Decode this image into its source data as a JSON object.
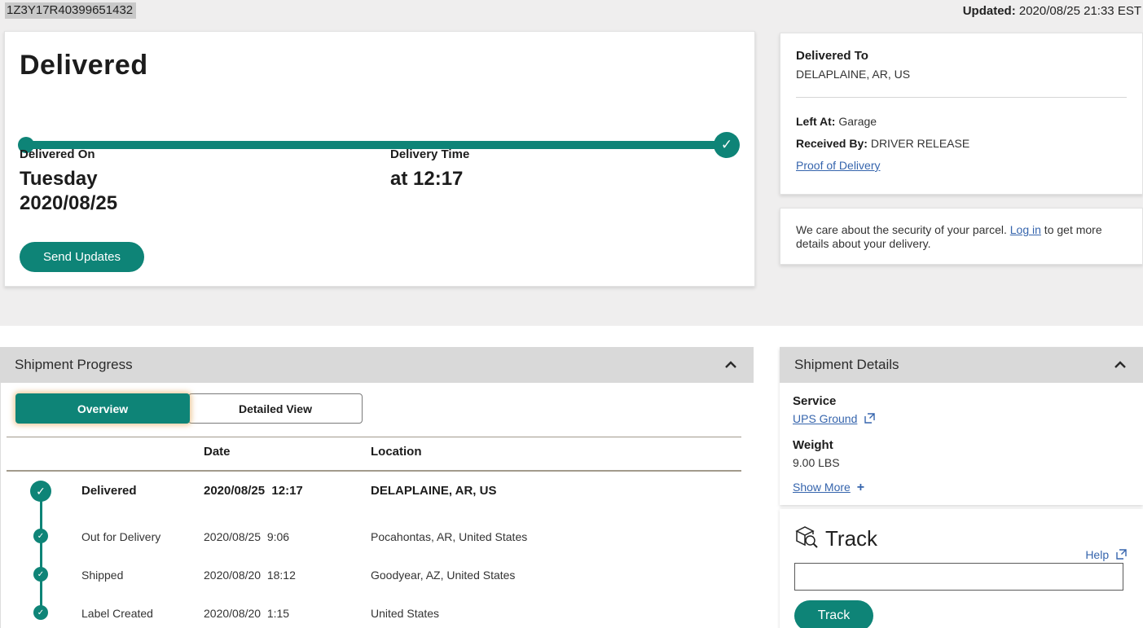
{
  "page": {
    "tracking_number": "1Z3Y17R40399651432",
    "updated_label": "Updated:",
    "updated_value": " 2020/08/25 21:33 EST"
  },
  "status_card": {
    "status": "Delivered",
    "delivered_on_label": "Delivered On",
    "delivered_on_day": "Tuesday",
    "delivered_on_date": "2020/08/25",
    "delivery_time_label": "Delivery Time",
    "delivery_time_value": "at 12:17",
    "send_updates_label": "Send Updates"
  },
  "delivered_to_card": {
    "title": "Delivered To",
    "address": "DELAPLAINE, AR, US",
    "left_at_label": "Left At:",
    "left_at_value": " Garage",
    "received_by_label": "Received By:",
    "received_by_value": " DRIVER RELEASE",
    "proof_link": "Proof of Delivery"
  },
  "security_card": {
    "text_before": "We care about the security of your parcel. ",
    "login_link": "Log in",
    "text_after": " to get more details about your delivery."
  },
  "shipment_progress": {
    "title": "Shipment Progress",
    "tabs": [
      {
        "label": "Overview"
      },
      {
        "label": "Detailed View"
      }
    ],
    "columns": {
      "date": "Date",
      "location": "Location"
    },
    "rows": [
      {
        "status": "Delivered",
        "date": "2020/08/25  12:17",
        "location": "DELAPLAINE, AR, US"
      },
      {
        "status": "Out for Delivery",
        "date": "2020/08/25  9:06",
        "location": "Pocahontas, AR, United States"
      },
      {
        "status": "Shipped",
        "date": "2020/08/20  18:12",
        "location": "Goodyear, AZ, United States"
      },
      {
        "status": "Label Created",
        "date": "2020/08/20  1:15",
        "location": "United States"
      }
    ]
  },
  "shipment_details": {
    "title": "Shipment Details",
    "service_label": "Service",
    "service_value": "UPS Ground",
    "weight_label": "Weight",
    "weight_value": "9.00 LBS",
    "show_more_label": "Show More"
  },
  "track_widget": {
    "title": "Track",
    "help_label": "Help",
    "input_value": "",
    "button_label": "Track"
  },
  "icons": {
    "check": "✓",
    "plus": "+",
    "collapse": "chevron-up",
    "external_link": "arrow-out-of-box",
    "track": "package-with-magnifier"
  },
  "colors": {
    "teal": "#0e8477",
    "link_blue": "#3665ad",
    "panel_header_gray": "#d9d9d9",
    "page_gray": "#efeeee",
    "divider_tan": "#a29a8c"
  }
}
